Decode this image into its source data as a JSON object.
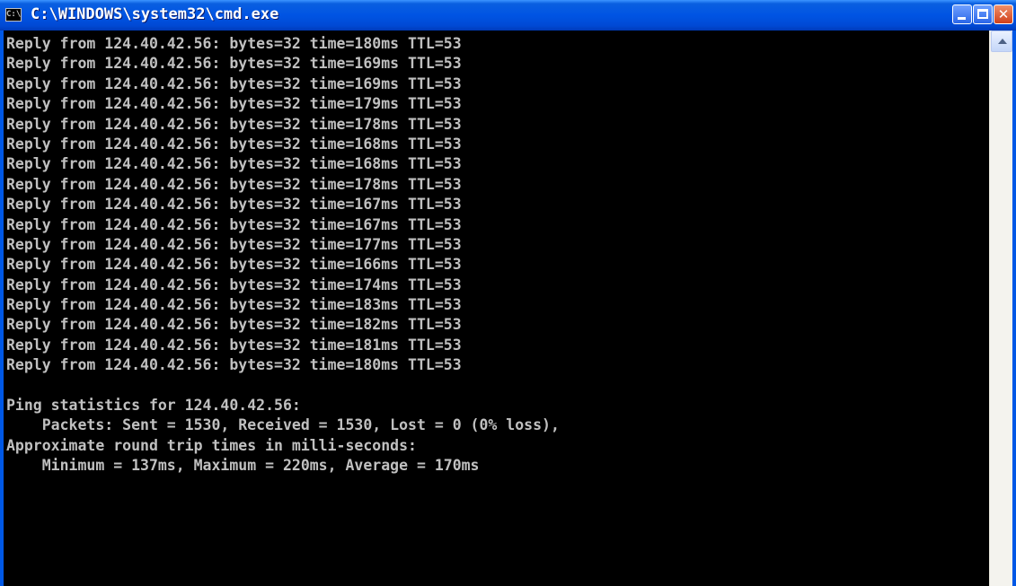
{
  "window": {
    "title": "C:\\WINDOWS\\system32\\cmd.exe",
    "icon_text": "C:\\",
    "buttons": {
      "minimize": "",
      "maximize": "",
      "close": "✕"
    }
  },
  "console": {
    "lines": [
      "Reply from 124.40.42.56: bytes=32 time=180ms TTL=53",
      "Reply from 124.40.42.56: bytes=32 time=169ms TTL=53",
      "Reply from 124.40.42.56: bytes=32 time=169ms TTL=53",
      "Reply from 124.40.42.56: bytes=32 time=179ms TTL=53",
      "Reply from 124.40.42.56: bytes=32 time=178ms TTL=53",
      "Reply from 124.40.42.56: bytes=32 time=168ms TTL=53",
      "Reply from 124.40.42.56: bytes=32 time=168ms TTL=53",
      "Reply from 124.40.42.56: bytes=32 time=178ms TTL=53",
      "Reply from 124.40.42.56: bytes=32 time=167ms TTL=53",
      "Reply from 124.40.42.56: bytes=32 time=167ms TTL=53",
      "Reply from 124.40.42.56: bytes=32 time=177ms TTL=53",
      "Reply from 124.40.42.56: bytes=32 time=166ms TTL=53",
      "Reply from 124.40.42.56: bytes=32 time=174ms TTL=53",
      "Reply from 124.40.42.56: bytes=32 time=183ms TTL=53",
      "Reply from 124.40.42.56: bytes=32 time=182ms TTL=53",
      "Reply from 124.40.42.56: bytes=32 time=181ms TTL=53",
      "Reply from 124.40.42.56: bytes=32 time=180ms TTL=53",
      "",
      "Ping statistics for 124.40.42.56:",
      "    Packets: Sent = 1530, Received = 1530, Lost = 0 (0% loss),",
      "Approximate round trip times in milli-seconds:",
      "    Minimum = 137ms, Maximum = 220ms, Average = 170ms"
    ]
  },
  "colors": {
    "console_background": "#000000",
    "console_text": "#c0c0c0",
    "titlebar": "#0054e3"
  }
}
